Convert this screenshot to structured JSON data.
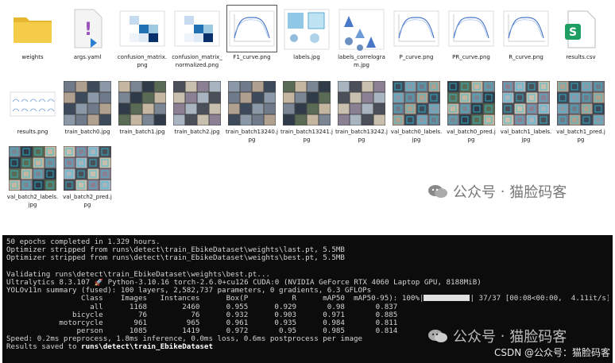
{
  "files": [
    {
      "name": "weights",
      "kind": "folder"
    },
    {
      "name": "args.yaml",
      "kind": "yaml"
    },
    {
      "name": "confusion_matrix.png",
      "kind": "cm"
    },
    {
      "name": "confusion_matrix_normalized.png",
      "kind": "cmn"
    },
    {
      "name": "F1_curve.png",
      "kind": "curve"
    },
    {
      "name": "labels.jpg",
      "kind": "labels"
    },
    {
      "name": "labels_correlogram.jpg",
      "kind": "correlogram"
    },
    {
      "name": "P_curve.png",
      "kind": "curve"
    },
    {
      "name": "PR_curve.png",
      "kind": "curve"
    },
    {
      "name": "R_curve.png",
      "kind": "curve"
    },
    {
      "name": "results.csv",
      "kind": "csv"
    },
    {
      "name": "results.png",
      "kind": "results"
    },
    {
      "name": "train_batch0.jpg",
      "kind": "photo"
    },
    {
      "name": "train_batch1.jpg",
      "kind": "photo"
    },
    {
      "name": "train_batch2.jpg",
      "kind": "photo"
    },
    {
      "name": "train_batch13240.jpg",
      "kind": "photo"
    },
    {
      "name": "train_batch13241.jpg",
      "kind": "photo"
    },
    {
      "name": "train_batch13242.jpg",
      "kind": "photo"
    },
    {
      "name": "val_batch0_labels.jpg",
      "kind": "photo"
    },
    {
      "name": "val_batch0_pred.jpg",
      "kind": "photo"
    },
    {
      "name": "val_batch1_labels.jpg",
      "kind": "photo"
    },
    {
      "name": "val_batch1_pred.jpg",
      "kind": "photo"
    },
    {
      "name": "val_batch2_labels.jpg",
      "kind": "photo"
    },
    {
      "name": "val_batch2_pred.jpg",
      "kind": "photo"
    }
  ],
  "selected_file": "F1_curve.png",
  "csv_icon_letter": "S",
  "watermark": {
    "separator": "·",
    "account": "公众号",
    "name": "猫脸码客"
  },
  "terminal": {
    "lines": [
      "50 epochs completed in 1.329 hours.",
      "Optimizer stripped from runs\\detect\\train_EbikeDataset\\weights\\last.pt, 5.5MB",
      "Optimizer stripped from runs\\detect\\train_EbikeDataset\\weights\\best.pt, 5.5MB",
      "",
      "Validating runs\\detect\\train_EbikeDataset\\weights\\best.pt...",
      "Ultralytics 8.3.107 🚀 Python-3.10.16 torch-2.6.0+cu126 CUDA:0 (NVIDIA GeForce RTX 4060 Laptop GPU, 8188MiB)",
      "YOLOv11n summary (fused): 100 layers, 2,582,737 parameters, 0 gradients, 6.3 GFLOPs"
    ],
    "table_header": [
      "Class",
      "Images",
      "Instances",
      "Box(P",
      "R",
      "mAP50",
      "mAP50-95):"
    ],
    "progress": {
      "percent_text": "100%",
      "fraction": 1.0,
      "tail": "37/37 [00:08<00:00,  4.11it/s]"
    },
    "rows": [
      [
        "all",
        "1168",
        "2460",
        "0.955",
        "0.929",
        "0.98",
        "0.837"
      ],
      [
        "bicycle",
        "76",
        "76",
        "0.932",
        "0.903",
        "0.971",
        "0.885"
      ],
      [
        "motorcycle",
        "961",
        "965",
        "0.961",
        "0.935",
        "0.984",
        "0.811"
      ],
      [
        "person",
        "1085",
        "1419",
        "0.972",
        "0.95",
        "0.985",
        "0.814"
      ]
    ],
    "speed_line": "Speed: 0.2ms preprocess, 1.8ms inference, 0.0ms loss, 0.6ms postprocess per image",
    "saved_prefix": "Results saved to ",
    "saved_path": "runs\\detect\\train_EbikeDataset"
  },
  "csdn_credit": "CSDN @公众号：猫脸码客"
}
